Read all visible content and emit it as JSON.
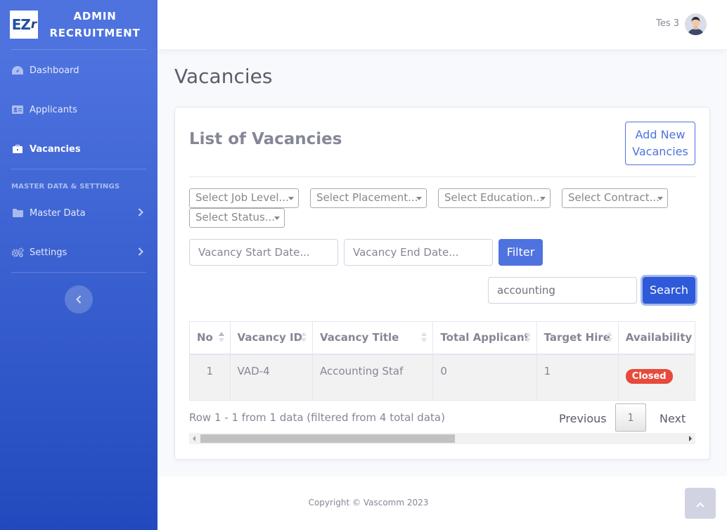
{
  "brand": {
    "logo_text": "EZr",
    "title_line1": "ADMIN",
    "title_line2": "RECRUITMENT"
  },
  "sidebar": {
    "items": [
      {
        "label": "Dashboard",
        "icon": "tachometer-icon",
        "active": false
      },
      {
        "label": "Applicants",
        "icon": "id-card-icon",
        "active": false
      },
      {
        "label": "Vacancies",
        "icon": "briefcase-icon",
        "active": true
      }
    ],
    "section_heading": "MASTER DATA & SETTINGS",
    "section_items": [
      {
        "label": "Master Data",
        "icon": "folder-icon"
      },
      {
        "label": "Settings",
        "icon": "cogs-icon"
      }
    ]
  },
  "topbar": {
    "user_name": "Tes 3"
  },
  "page": {
    "title": "Vacancies"
  },
  "card": {
    "title": "List of Vacancies",
    "add_button": "Add New Vacancies"
  },
  "filters": {
    "job_level": "Select Job Level...",
    "placement": "Select Placement...",
    "education": "Select Education...",
    "contract": "Select Contract...",
    "status": "Select Status...",
    "start_date_placeholder": "Vacancy Start Date...",
    "end_date_placeholder": "Vacancy End Date...",
    "filter_button": "Filter"
  },
  "search": {
    "value": "accounting",
    "button": "Search"
  },
  "table": {
    "columns": [
      "No",
      "Vacancy ID",
      "Vacancy Title",
      "Total Applicant",
      "Target Hire",
      "Availability"
    ],
    "rows": [
      {
        "no": "1",
        "vacancy_id": "VAD-4",
        "title": "Accounting Staf",
        "total_applicant": "0",
        "target_hire": "1",
        "availability": "Closed"
      }
    ]
  },
  "table_info": "Row 1 - 1 from 1 data (filtered from 4 total data)",
  "pagination": {
    "previous": "Previous",
    "current": "1",
    "next": "Next"
  },
  "footer": {
    "copyright": "Copyright © Vascomm 2023"
  },
  "colors": {
    "primary": "#4e73df",
    "sidebar_bottom": "#224abe",
    "danger": "#e74a3b"
  }
}
